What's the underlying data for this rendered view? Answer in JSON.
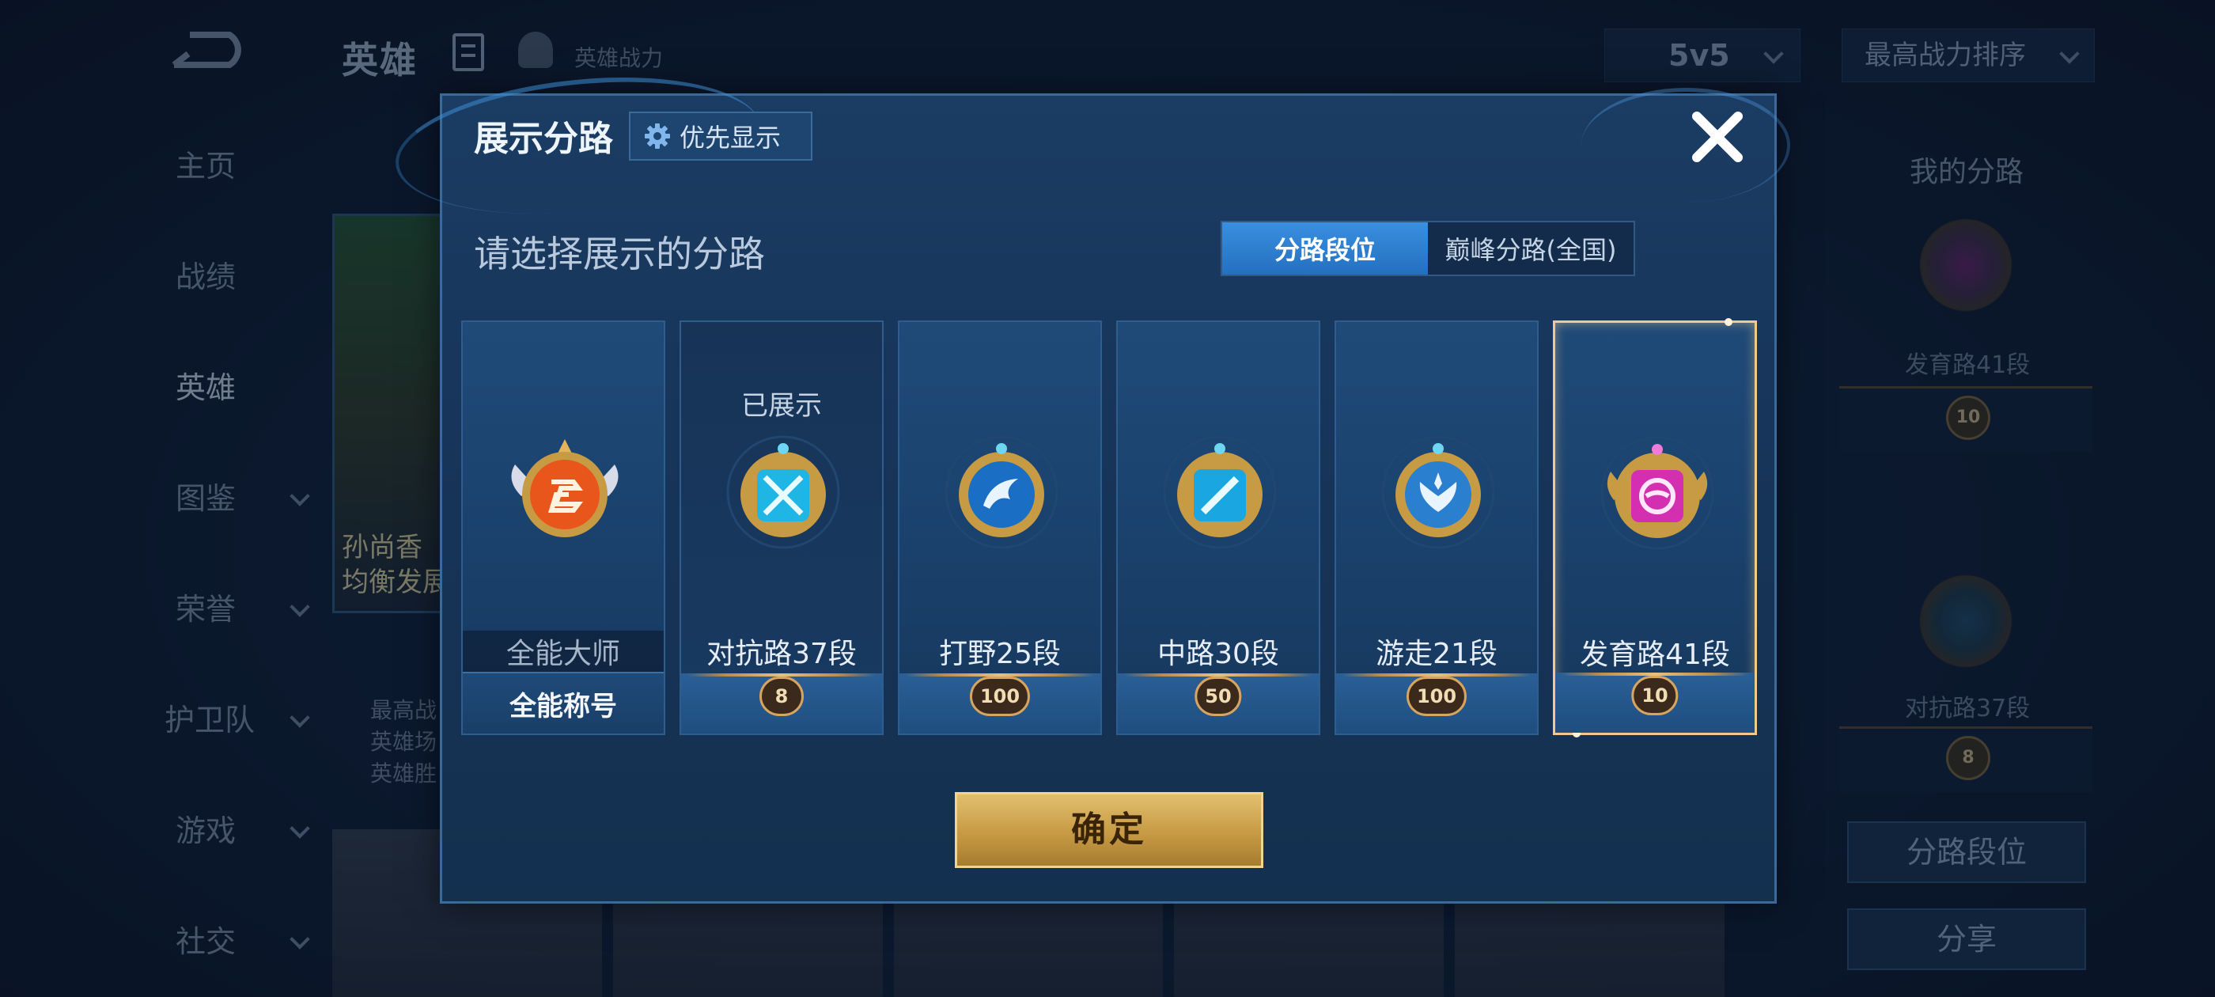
{
  "background": {
    "page_title": "英雄",
    "hero_power_label": "英雄战力",
    "mode_select": "5v5",
    "sort_select": "最高战力排序",
    "nav": [
      "主页",
      "战绩",
      "英雄",
      "图鉴",
      "荣誉",
      "护卫队",
      "游戏",
      "社交"
    ],
    "active_nav": "英雄",
    "hero_card_text": [
      "孙尚香",
      "均衡发展"
    ],
    "hero_stats": [
      "最高战",
      "英雄场",
      "英雄胜"
    ],
    "right_panel": {
      "title": "我的分路",
      "lane1_label": "发育路41段",
      "lane1_rank": "10",
      "lane2_label": "对抗路37段",
      "lane2_rank": "8",
      "btn_lane_rank": "分路段位",
      "btn_share": "分享"
    }
  },
  "modal": {
    "title": "展示分路",
    "priority_label": "优先显示",
    "subtitle": "请选择展示的分路",
    "tabs": {
      "active": "分路段位",
      "inactive": "巅峰分路(全国)"
    },
    "cards": [
      {
        "label": "全能大师",
        "footer_title": "全能称号",
        "tag": "",
        "rank": "",
        "emblem_color": "#e8561c",
        "state": "normal"
      },
      {
        "label": "对抗路37段",
        "footer_title": "",
        "tag": "已展示",
        "rank": "8",
        "emblem_color": "#1fb6e6",
        "state": "shown"
      },
      {
        "label": "打野25段",
        "footer_title": "",
        "tag": "",
        "rank": "100",
        "emblem_color": "#1a6fc4",
        "state": "normal"
      },
      {
        "label": "中路30段",
        "footer_title": "",
        "tag": "",
        "rank": "50",
        "emblem_color": "#1aa6e0",
        "state": "normal"
      },
      {
        "label": "游走21段",
        "footer_title": "",
        "tag": "",
        "rank": "100",
        "emblem_color": "#2a7fcf",
        "state": "normal"
      },
      {
        "label": "发育路41段",
        "footer_title": "",
        "tag": "",
        "rank": "10",
        "emblem_color": "#d42fb0",
        "state": "selected"
      }
    ],
    "confirm_label": "确定",
    "colors": {
      "accent_gold": "#e2bf6e",
      "tab_active": "#2f80d0",
      "selected_border": "#f2c98a"
    }
  }
}
